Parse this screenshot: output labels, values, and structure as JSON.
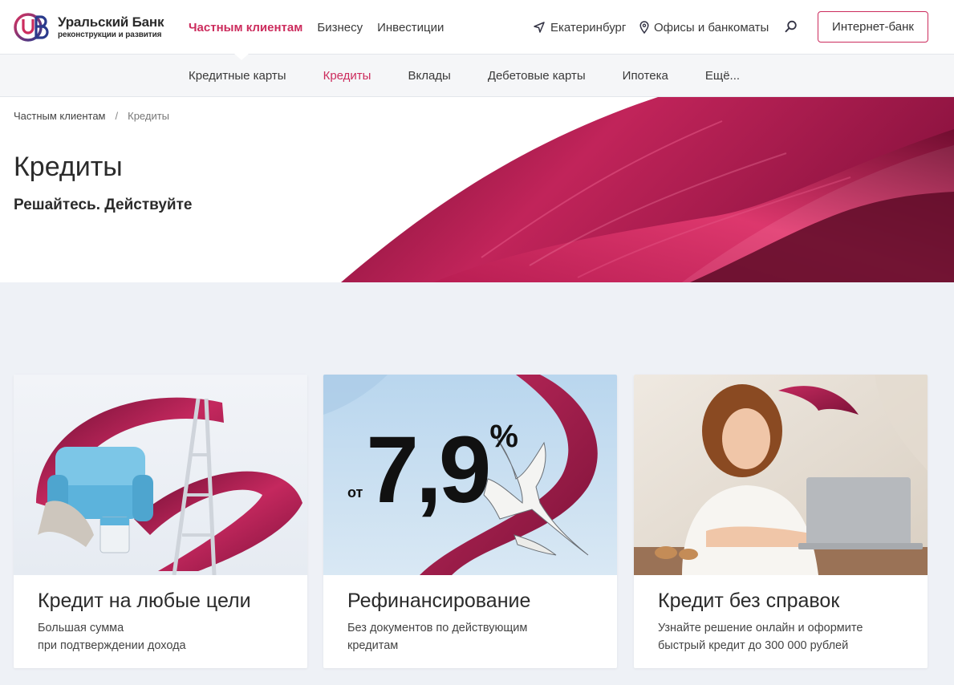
{
  "brand": {
    "name": "Уральский Банк",
    "tagline": "реконструкции и развития",
    "accent": "#cc2c5d"
  },
  "header": {
    "nav": [
      {
        "label": "Частным клиентам",
        "active": true
      },
      {
        "label": "Бизнесу",
        "active": false
      },
      {
        "label": "Инвестиции",
        "active": false
      }
    ],
    "city": "Екатеринбург",
    "offices": "Офисы и банкоматы",
    "internet_bank": "Интернет-банк"
  },
  "subnav": [
    {
      "label": "Кредитные карты",
      "active": false
    },
    {
      "label": "Кредиты",
      "active": true
    },
    {
      "label": "Вклады",
      "active": false
    },
    {
      "label": "Дебетовые карты",
      "active": false
    },
    {
      "label": "Ипотека",
      "active": false
    },
    {
      "label": "Ещё...",
      "active": false
    }
  ],
  "breadcrumb": {
    "parent": "Частным клиентам",
    "separator": "/",
    "current": "Кредиты"
  },
  "hero": {
    "title": "Кредиты",
    "subtitle": "Решайтесь. Действуйте"
  },
  "cards": [
    {
      "title": "Кредит на любые цели",
      "desc": [
        "Большая сумма",
        "при подтверждении дохода"
      ]
    },
    {
      "title": "Рефинансирование",
      "desc": [
        "Без документов по действующим",
        "кредитам"
      ],
      "promo_prefix": "от",
      "promo_rate": "7,9",
      "promo_unit": "%"
    },
    {
      "title": "Кредит без справок",
      "desc": [
        "Узнайте решение онлайн и оформите",
        "быстрый кредит до 300 000 рублей"
      ]
    }
  ]
}
